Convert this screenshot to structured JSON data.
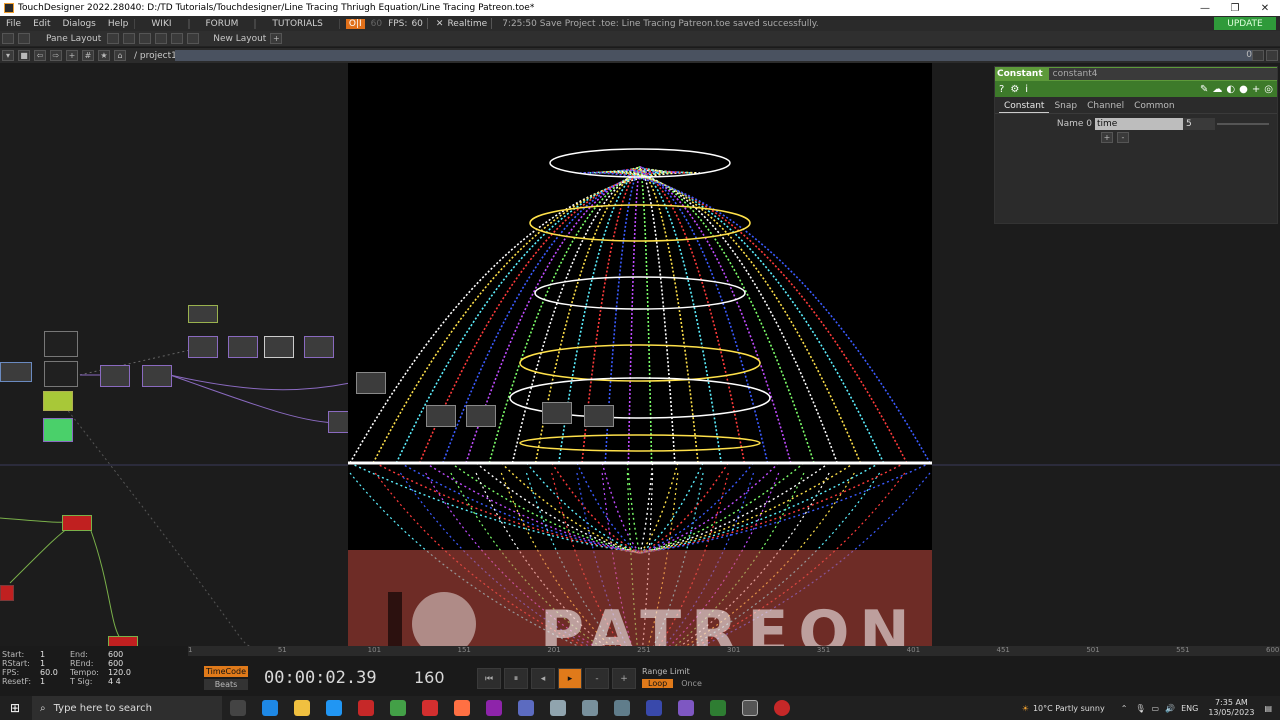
{
  "window": {
    "title": "TouchDesigner 2022.28040: D:/TD Tutorials/Touchdesigner/Line Tracing Thriugh Equation/Line Tracing Patreon.toe*",
    "controls": [
      "—",
      "❐",
      "✕"
    ]
  },
  "menu": {
    "items": [
      "File",
      "Edit",
      "Dialogs",
      "Help"
    ],
    "wiki": "WIKI",
    "forum": "FORUM",
    "tutorials": "TUTORIALS",
    "oi": "O|I",
    "fps_alt": "60",
    "fps_label": "FPS:",
    "fps_value": "60",
    "realtime": "Realtime",
    "status": "7:25:50 Save Project .toe: Line Tracing Patreon.toe saved successfully.",
    "update": "UPDATE"
  },
  "panebar": {
    "pane_layout": "Pane Layout",
    "new_layout": "New Layout",
    "plus": "+"
  },
  "pathbar": {
    "path": "/ project1 / >>",
    "right_count": "0"
  },
  "params": {
    "op_type": "Constant",
    "op_name": "constant4",
    "tabs": [
      "Constant",
      "Snap",
      "Channel",
      "Common"
    ],
    "row_label": "Name 0",
    "row_name": "time",
    "row_value": "5",
    "plus": "+",
    "minus": "-"
  },
  "overlay": {
    "patreon": "PATREON"
  },
  "timeline": {
    "ruler_ticks": [
      "1",
      "51",
      "101",
      "151",
      "201",
      "251",
      "301",
      "351",
      "401",
      "451",
      "501",
      "551",
      "600"
    ],
    "info": [
      {
        "k": "Start:",
        "v": "1",
        "k2": "End:",
        "v2": "600"
      },
      {
        "k": "RStart:",
        "v": "1",
        "k2": "REnd:",
        "v2": "600"
      },
      {
        "k": "FPS:",
        "v": "60.0",
        "k2": "Tempo:",
        "v2": "120.0"
      },
      {
        "k": "ResetF:",
        "v": "1",
        "k2": "T Sig:",
        "v2": "4    4"
      }
    ],
    "timecode_label": "TimeCode",
    "beats_label": "Beats",
    "timecode": "00:00:02.39",
    "frame": "160",
    "range_limit": "Range Limit",
    "loop": "Loop",
    "once": "Once",
    "buttons": [
      "⏮",
      "⏸",
      "◂",
      "▸",
      "-",
      "+"
    ]
  },
  "taskbar": {
    "search_placeholder": "Type here to search",
    "weather": "10°C  Partly sunny",
    "lang": "ENG",
    "time": "7:35 AM",
    "date": "13/05/2023"
  },
  "colors": {
    "update_bg": "#2f9a3a",
    "param_header": "#5d9a3a",
    "oi_orange": "#e0701a",
    "play_orange": "#e07a1a"
  }
}
